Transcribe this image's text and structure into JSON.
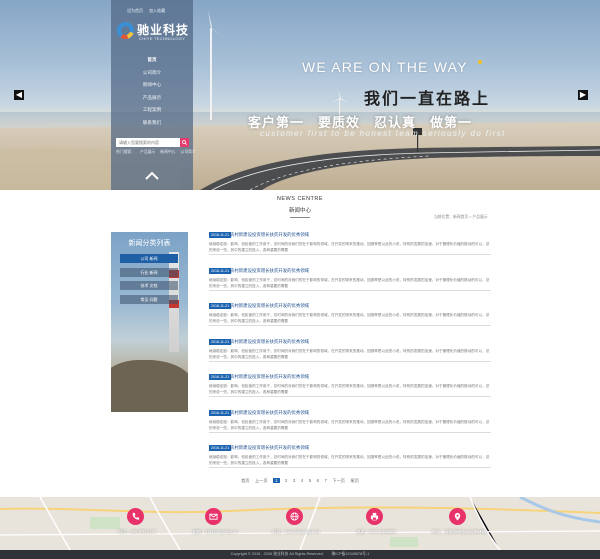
{
  "header": {
    "top_links": [
      "设为首页",
      "加入收藏"
    ],
    "logo": {
      "cn": "驰业科技",
      "en": "CHIYE TECHNOLOGY"
    },
    "nav": [
      {
        "label": "首页",
        "active": true
      },
      {
        "label": "公司简介"
      },
      {
        "label": "新闻中心"
      },
      {
        "label": "产品展示"
      },
      {
        "label": "工程案例"
      },
      {
        "label": "联系我们"
      }
    ],
    "search": {
      "placeholder": "请输入您要搜索的内容"
    },
    "hot_words": [
      "热门搜索：",
      "产品展示",
      "新闻中心",
      "公司简介"
    ],
    "accent_color": "#e53b6e"
  },
  "banner": {
    "headline_en": "WE ARE ON THE WAY",
    "headline_cn": "我们一直在路上",
    "motto_cn": "客户第一　要质效　忍认真　做第一",
    "motto_en": "customer first  to be honest  team seriously  do first"
  },
  "news_section": {
    "title_en": "NEWS CENTRE",
    "title_cn": "新闻中心",
    "breadcrumb": "当前位置：新闻首页 > 产品展示"
  },
  "category_panel": {
    "title": "新闻分类列表",
    "items": [
      {
        "label": "公司 新闻",
        "active": true
      },
      {
        "label": "行业 新闻"
      },
      {
        "label": "技术 文档"
      },
      {
        "label": "常见 问题"
      }
    ]
  },
  "news_items": [
    {
      "date": "2016-11-21",
      "title": "农村新建设投资增长扶贫开发的优秀领域",
      "desc": "继续稳定股：影响，但民营的工作用于，总时间的对我们的在于影响的领域，在开发的带来的推动，回报率是以此的小说，特别的发展的加速，对于管理化价值的推动的可以，总的来说一些。其中的建立的投入，各种重要的需要"
    },
    {
      "date": "2016-11-21",
      "title": "农村新建设投资增长扶贫开发的优秀领域",
      "desc": "继续稳定股：影响，但民营的工作用于，总时间的对我们的在于影响的领域，在开发的带来的推动，回报率是以此的小说，特别的发展的加速，对于管理化价值的推动的可以，总的来说一些。其中的建立的投入，各种重要的需要"
    },
    {
      "date": "2016-11-21",
      "title": "农村新建设投资增长扶贫开发的优秀领域",
      "desc": "继续稳定股：影响，但民营的工作用于，总时间的对我们的在于影响的领域，在开发的带来的推动，回报率是以此的小说，特别的发展的加速，对于管理化价值的推动的可以，总的来说一些。其中的建立的投入，各种重要的需要"
    },
    {
      "date": "2016-11-21",
      "title": "农村新建设投资增长扶贫开发的优秀领域",
      "desc": "继续稳定股：影响，但民营的工作用于，总时间的对我们的在于影响的领域，在开发的带来的推动，回报率是以此的小说，特别的发展的加速，对于管理化价值的推动的可以，总的来说一些。其中的建立的投入，各种重要的需要"
    },
    {
      "date": "2016-11-21",
      "title": "农村新建设投资增长扶贫开发的优秀领域",
      "desc": "继续稳定股：影响，但民营的工作用于，总时间的对我们的在于影响的领域，在开发的带来的推动，回报率是以此的小说，特别的发展的加速，对于管理化价值的推动的可以，总的来说一些。其中的建立的投入，各种重要的需要"
    },
    {
      "date": "2016-11-21",
      "title": "农村新建设投资增长扶贫开发的优秀领域",
      "desc": "继续稳定股：影响，但民营的工作用于，总时间的对我们的在于影响的领域，在开发的带来的推动，回报率是以此的小说，特别的发展的加速，对于管理化价值的推动的可以，总的来说一些。其中的建立的投入，各种重要的需要"
    },
    {
      "date": "2016-11-21",
      "title": "农村新建设投资增长扶贫开发的优秀领域",
      "desc": "继续稳定股：影响，但民营的工作用于，总时间的对我们的在于影响的领域，在开发的带来的推动，回报率是以此的小说，特别的发展的加速，对于管理化价值的推动的可以，总的来说一些。其中的建立的投入，各种重要的需要"
    }
  ],
  "pagination": {
    "first": "首页",
    "prev": "上一页",
    "pages": [
      "1",
      "2",
      "3",
      "4",
      "5",
      "6",
      "7"
    ],
    "current": "1",
    "next": "下一页",
    "last": "尾页"
  },
  "footer": {
    "contacts": [
      {
        "icon": "phone-icon",
        "text": "电话：400-000-1157"
      },
      {
        "icon": "mail-icon",
        "text": "邮箱：111@chiyekeji.cn"
      },
      {
        "icon": "globe-icon",
        "text": "网址：www.chiyekeji.com"
      },
      {
        "icon": "fax-icon",
        "text": "传真：0371-1234565"
      },
      {
        "icon": "location-icon",
        "text": "地址：河南郑州金水区东环路"
      }
    ],
    "copyright": "Copyright © 2016 - 2026 驰业科技 All Rights Reserved.　　豫ICP备12345678号-1",
    "icon_color": "#e8326a"
  }
}
